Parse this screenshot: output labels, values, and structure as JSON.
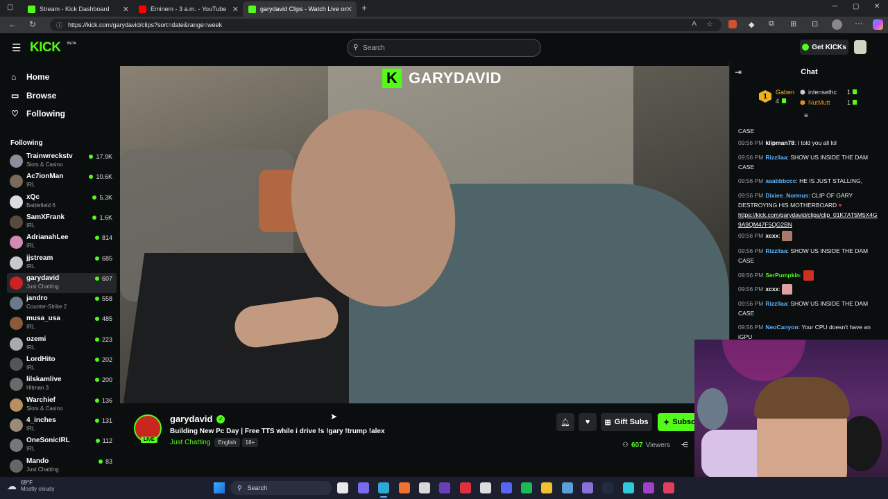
{
  "browser": {
    "tabs": [
      {
        "title": "Stream - Kick Dashboard",
        "color": "#53fc18"
      },
      {
        "title": "Eminem - 3 a.m. - YouTube",
        "color": "#ff0000"
      },
      {
        "title": "garydavid Clips - Watch Live on K",
        "color": "#53fc18"
      }
    ],
    "url": "https://kick.com/garydavid/clips?sort=date&range=week"
  },
  "header": {
    "logo": "KICK",
    "logo_badge": "BETA",
    "search_placeholder": "Search",
    "get_kicks": "Get KICKs"
  },
  "sidebar": {
    "nav": [
      {
        "label": "Home",
        "icon": "home-icon"
      },
      {
        "label": "Browse",
        "icon": "browse-icon"
      },
      {
        "label": "Following",
        "icon": "heart-icon"
      }
    ],
    "following_title": "Following",
    "channels": [
      {
        "name": "Trainwreckstv",
        "category": "Slots & Casino",
        "viewers": "17.9K",
        "color": "#8a8f99"
      },
      {
        "name": "Ac7ionMan",
        "category": "IRL",
        "viewers": "10.6K",
        "color": "#7a6a5a"
      },
      {
        "name": "xQc",
        "category": "Battlefield 6",
        "viewers": "5.3K",
        "color": "#dddddd"
      },
      {
        "name": "SamXFrank",
        "category": "IRL",
        "viewers": "1.6K",
        "color": "#5a4a3a"
      },
      {
        "name": "AdrianahLee",
        "category": "IRL",
        "viewers": "814",
        "color": "#d48ab0"
      },
      {
        "name": "jjstream",
        "category": "IRL",
        "viewers": "685",
        "color": "#c8c8c8"
      },
      {
        "name": "garydavid",
        "category": "Just Chatting",
        "viewers": "607",
        "color": "#cc2222"
      },
      {
        "name": "jandro",
        "category": "Counter-Strike 2",
        "viewers": "558",
        "color": "#6a7a8a"
      },
      {
        "name": "musa_usa",
        "category": "IRL",
        "viewers": "485",
        "color": "#8a5a3a"
      },
      {
        "name": "ozemi",
        "category": "IRL",
        "viewers": "223",
        "color": "#aaaaaa"
      },
      {
        "name": "LordHito",
        "category": "IRL",
        "viewers": "202",
        "color": "#555555"
      },
      {
        "name": "lilskamlive",
        "category": "Hitman 3",
        "viewers": "200",
        "color": "#6a6a6a"
      },
      {
        "name": "Warchief",
        "category": "Slots & Casino",
        "viewers": "136",
        "color": "#b89060"
      },
      {
        "name": "4_inches",
        "category": "IRL",
        "viewers": "131",
        "color": "#9a8a7a"
      },
      {
        "name": "OneSonicIRL",
        "category": "IRL",
        "viewers": "112",
        "color": "#777777"
      },
      {
        "name": "Mando",
        "category": "Just Chatting",
        "viewers": "83",
        "color": "#666666"
      }
    ]
  },
  "video": {
    "overlay_title": "GARYDAVID"
  },
  "stream": {
    "channel": "garydavid",
    "title": "Building New Pc Day | Free TTS while i drive !s !gary !trump !alex",
    "category": "Just Chatting",
    "tags": [
      "English",
      "18+"
    ],
    "live_badge": "LIVE",
    "gift_subs": "Gift Subs",
    "subscribe": "Subsc",
    "viewers_count": "607",
    "viewers_label": "Viewers"
  },
  "chat": {
    "title": "Chat",
    "leaderboard": [
      {
        "rank": "1",
        "name": "Gaben",
        "count": "4"
      },
      {
        "name": "intensethc",
        "count": "1"
      },
      {
        "name": "NutMutt",
        "count": "1"
      }
    ],
    "messages": [
      {
        "time": "",
        "user": "",
        "text": "CASE",
        "color": "#ffffff"
      },
      {
        "time": "09:56 PM",
        "user": "klipman78",
        "text": "I told you all lol",
        "color": "#ffffff"
      },
      {
        "time": "09:56 PM",
        "user": "Rizzllaa",
        "text": "SHOW US INSIDE THE DAM CASE",
        "color": "#5fb4ff"
      },
      {
        "time": "09:56 PM",
        "user": "aaabbbccc",
        "text": "HE IS JUST STALLING,",
        "color": "#5fb4ff"
      },
      {
        "time": "09:56 PM",
        "user": "Dixiee_Normus",
        "text": "CLIP OF GARY DESTROYING HIS MOTHERBOARD",
        "color": "#5fb4ff",
        "link": "https://kick.com/garydavid/clips/clip_01K7AT5M5X4G9A9QM47F5QG2BN"
      },
      {
        "time": "09:56 PM",
        "user": "xcxx",
        "text": "",
        "color": "#ffffff",
        "emote": "#a87868"
      },
      {
        "time": "09:56 PM",
        "user": "Rizzllaa",
        "text": "SHOW US INSIDE THE DAM CASE",
        "color": "#5fb4ff"
      },
      {
        "time": "09:56 PM",
        "user": "SerPumpkin",
        "text": "",
        "color": "#53fc18",
        "emote": "#d03020"
      },
      {
        "time": "09:56 PM",
        "user": "xcxx",
        "text": "",
        "color": "#ffffff",
        "emote": "#e0a0a0"
      },
      {
        "time": "09:56 PM",
        "user": "Rizzllaa",
        "text": "SHOW US INSIDE THE DAM CASE",
        "color": "#5fb4ff"
      },
      {
        "time": "09:56 PM",
        "user": "NeoCanyon",
        "text": "Your CPU doesn't have an iGPU",
        "color": "#5fb4ff"
      }
    ]
  },
  "taskbar": {
    "weather_temp": "69°F",
    "weather_desc": "Mostly cloudy",
    "search": "Search"
  },
  "colors": {
    "accent": "#53fc18",
    "background": "#0b0e0f"
  }
}
